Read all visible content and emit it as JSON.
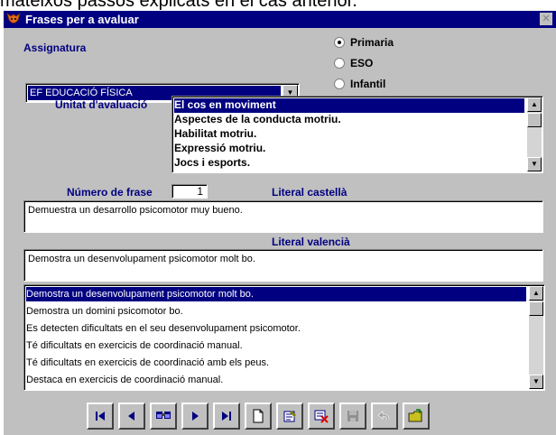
{
  "background_text": "mateixos passos explicats en el cas anterior.",
  "window": {
    "title": "Frases per a avaluar",
    "close_symbol": "✕"
  },
  "assignatura": {
    "label": "Assignatura",
    "selected": "EF  EDUCACIÓ FÍSICA"
  },
  "level": {
    "options": [
      {
        "label": "Primaria",
        "selected": true
      },
      {
        "label": "ESO",
        "selected": false
      },
      {
        "label": "Infantil",
        "selected": false
      }
    ]
  },
  "unitat": {
    "label": "Unitat d'avaluació",
    "items": [
      "El cos en moviment",
      "Aspectes de la conducta motriu.",
      "Habilitat motriu.",
      "Expressió motriu.",
      "Jocs i esports."
    ],
    "selected_index": 0
  },
  "numero": {
    "label": "Número de frase",
    "value": "1"
  },
  "castella": {
    "label": "Literal castellà",
    "value": "Demuestra un desarrollo psicomotor muy bueno."
  },
  "valencia": {
    "label": "Literal valencià",
    "value": "Demostra un desenvolupament psicomotor molt bo."
  },
  "phrases": {
    "items": [
      "Demostra un desenvolupament psicomotor molt bo.",
      "Demostra un domini psicomotor bo.",
      "Es detecten dificultats en el seu desenvolupament psicomotor.",
      "Té dificultats en exercicis de coordinació manual.",
      "Té dificultats en exercicis de coordinació amb els peus.",
      "Destaca en exercicis de coordinació manual."
    ],
    "selected_index": 0
  },
  "toolbar": {
    "buttons": [
      "first-icon",
      "previous-icon",
      "search-icon",
      "next-icon",
      "last-icon",
      "new-icon",
      "edit-icon",
      "delete-icon",
      "save-icon",
      "undo-icon",
      "exit-icon"
    ]
  },
  "colors": {
    "titlebar": "#000080",
    "selection": "#000080",
    "window": "#c0c0c0",
    "label": "#000080"
  }
}
